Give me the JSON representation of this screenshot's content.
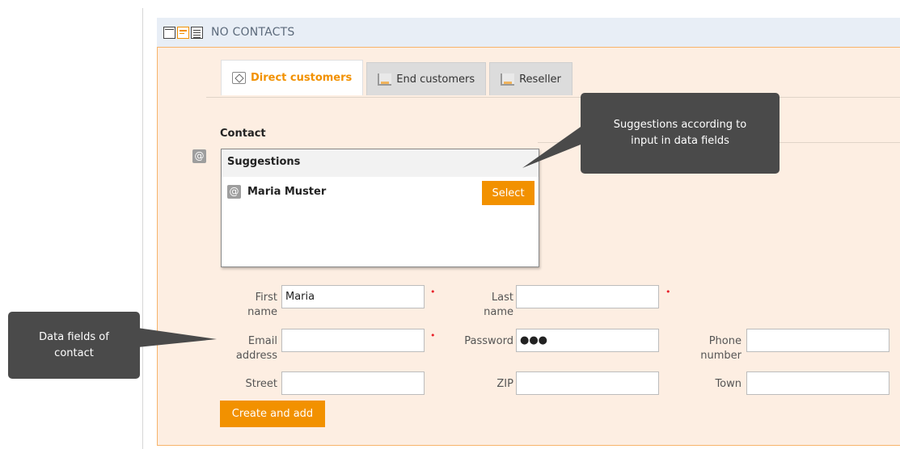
{
  "header": {
    "title": "NO CONTACTS"
  },
  "tabs": [
    {
      "label": "Direct customers",
      "icon": "diamond-icon",
      "active": true
    },
    {
      "label": "End customers",
      "icon": "chart-icon",
      "active": false
    },
    {
      "label": "Reseller",
      "icon": "chart-icon",
      "active": false
    }
  ],
  "contact": {
    "section_label": "Contact",
    "suggestions": {
      "heading": "Suggestions",
      "items": [
        {
          "name": "Maria Muster",
          "button_label": "Select"
        }
      ]
    }
  },
  "form": {
    "first_name": {
      "label": "First name",
      "value": "Maria",
      "required": true
    },
    "last_name": {
      "label": "Last name",
      "value": "",
      "required": true
    },
    "email": {
      "label": "Email address",
      "value": "",
      "required": true
    },
    "password": {
      "label": "Password",
      "value": "●●●"
    },
    "phone": {
      "label": "Phone number",
      "value": ""
    },
    "street": {
      "label": "Street",
      "value": ""
    },
    "zip": {
      "label": "ZIP",
      "value": ""
    },
    "town": {
      "label": "Town",
      "value": ""
    },
    "submit_label": "Create and add"
  },
  "callouts": {
    "suggestions": "Suggestions according to input in data fields",
    "data_fields": "Data fields of contact"
  },
  "colors": {
    "accent": "#f29100",
    "panel_bg": "#fdeee2",
    "header_bg": "#e8eef6",
    "callout_bg": "#4a4a4a",
    "required": "#e8202a"
  }
}
